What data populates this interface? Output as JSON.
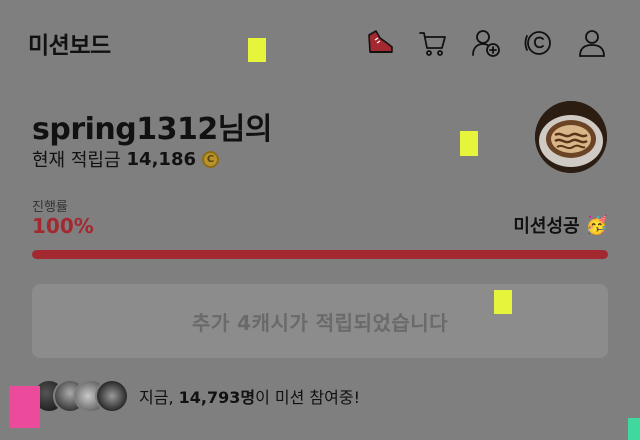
{
  "header": {
    "title": "미션보드",
    "icons": [
      "sneaker-icon",
      "cart-icon",
      "add-friend-icon",
      "coin-history-icon",
      "profile-icon"
    ]
  },
  "user": {
    "username": "spring1312",
    "username_suffix": "님의",
    "points_label": "현재 적립금",
    "points_value": "14,186",
    "coin_symbol": "C"
  },
  "progress": {
    "label": "진행률",
    "value_text": "100%",
    "fraction": 1.0,
    "status": "미션성공",
    "status_emoji": "🥳"
  },
  "reward": {
    "message": "추가 4캐시가 적립되었습니다"
  },
  "participants": {
    "prefix": "지금,",
    "count": "14,793명",
    "suffix": "이 미션 참여중!"
  },
  "colors": {
    "accent": "#a3282f",
    "overlay": "#7f7f7f",
    "markers": [
      "#e6f53b",
      "#e6f53b",
      "#e6f53b",
      "#ec4a9a",
      "#3fd9a0"
    ]
  }
}
